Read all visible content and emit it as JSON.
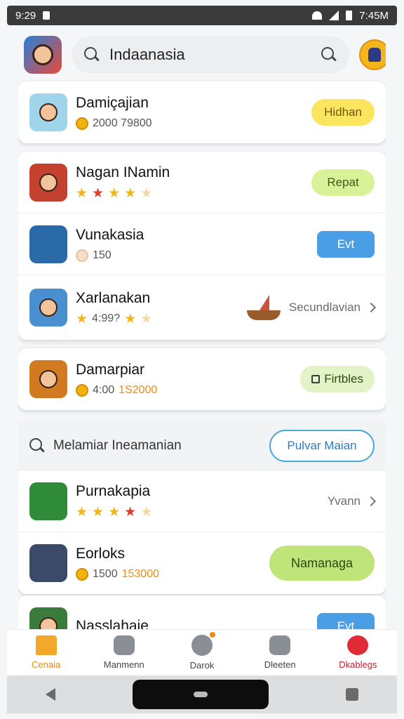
{
  "status_bar": {
    "time": "9:29",
    "right_time": "7:45M"
  },
  "search": {
    "value": "Indaanasia"
  },
  "cards": [
    [
      {
        "title": "Damiçajian",
        "meta": "2000  79800",
        "button": "Hidhan"
      }
    ],
    [
      {
        "title": "Nagan INamin",
        "button": "Repat"
      },
      {
        "title": "Vunakasia",
        "meta": "150",
        "button": "Evt"
      },
      {
        "title": "Xarlanakan",
        "meta": "4:99?",
        "link": "Secundlavian"
      }
    ],
    [
      {
        "title": "Damarpiar",
        "meta": "4:00",
        "meta_highlight": "1S2000",
        "button": "Firtbles"
      }
    ],
    [
      {
        "search_label": "Melamiar Ineamanian",
        "button": "Pulvar Maian"
      },
      {
        "title": "Purnakapia",
        "link": "Yvann"
      },
      {
        "title": "Eorloks",
        "meta": "1500",
        "meta_highlight": "153000",
        "button": "Namanaga"
      }
    ],
    [
      {
        "title": "Nasslahaie",
        "button": "Evt"
      }
    ]
  ],
  "tabs": [
    "Cenaia",
    "Manmenn",
    "Darok",
    "Dleeten",
    "Dkablegs"
  ],
  "colors": {
    "accent": "#f2a82a",
    "blue": "#4a9ee6",
    "lime": "#d9f29a",
    "yellow": "#fbe55e"
  }
}
